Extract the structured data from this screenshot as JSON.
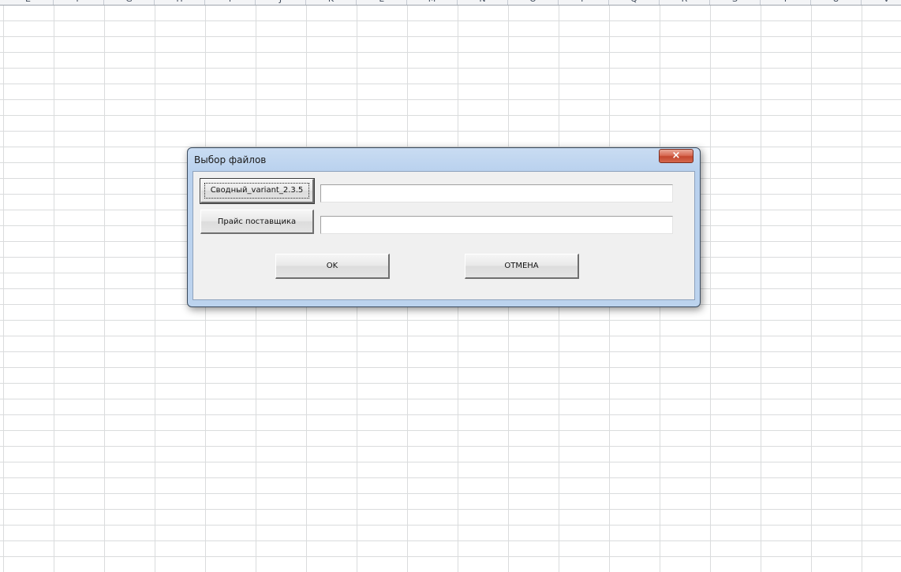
{
  "spreadsheet": {
    "column_headers": [
      "E",
      "F",
      "G",
      "H",
      "I",
      "J",
      "K",
      "L",
      "M",
      "N",
      "O",
      "P",
      "Q",
      "R",
      "S",
      "T",
      "U",
      "V"
    ]
  },
  "dialog": {
    "title": "Выбор файлов",
    "close_label": "×",
    "buttons": {
      "svodny_label": "Сводный_variant_2.3.5",
      "price_label": "Прайс поставщика",
      "ok_label": "OK",
      "cancel_label": "ОТМЕНА"
    },
    "fields": {
      "svodny_value": "",
      "price_value": ""
    }
  },
  "colors": {
    "title_bar": "#b9d1ee",
    "close_button": "#c3472e",
    "dialog_body": "#f0f0f0",
    "grid_lines": "#dadcdd"
  }
}
